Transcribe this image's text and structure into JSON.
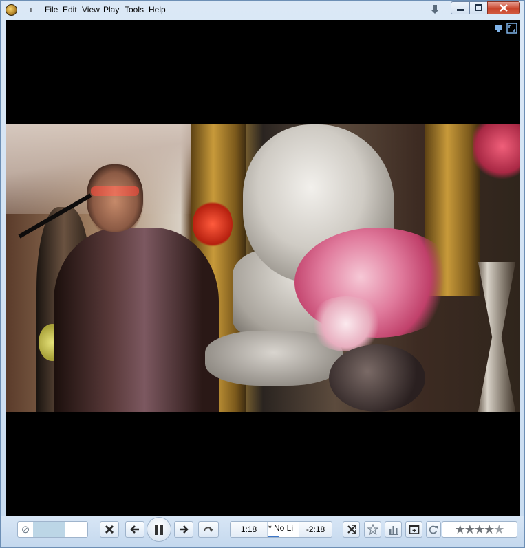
{
  "titlebar": {
    "add_label": "+",
    "menu": [
      "File",
      "Edit",
      "View",
      "Play",
      "Tools",
      "Help"
    ]
  },
  "icons": {
    "app_logo": "media-player-logo-icon",
    "pin": "pin-down-icon",
    "minimize": "minimize-icon",
    "maximize": "maximize-icon",
    "close": "close-icon",
    "video_top": "mini-player-icon",
    "fullscreen": "fullscreen-icon",
    "mute": "mute-icon",
    "stop": "stop-x-icon",
    "previous": "previous-arrow-icon",
    "pause": "pause-icon",
    "next": "next-arrow-icon",
    "repeat": "repeat-icon",
    "shuffle": "shuffle-icon",
    "favorite": "star-outline-icon",
    "equalizer": "equalizer-icon",
    "add_window": "add-to-playlist-icon",
    "refresh": "refresh-icon"
  },
  "controls": {
    "volume_fraction": 0.58,
    "elapsed": "1:18",
    "track_title": "* No Li",
    "remaining": "-2:18",
    "rating_stars": 4.5,
    "rating_glyphs": [
      "★",
      "★",
      "★",
      "★",
      "★"
    ]
  },
  "colors": {
    "window_bg": "#cfe0f1",
    "close_button": "#c9452c",
    "progress": "#3f78c9",
    "volume_fill": "#bcd6e6"
  }
}
